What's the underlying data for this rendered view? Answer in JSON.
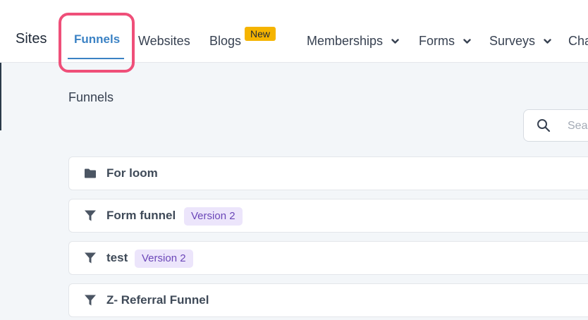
{
  "nav": {
    "title": "Sites",
    "items": [
      {
        "label": "Funnels",
        "active": true
      },
      {
        "label": "Websites"
      },
      {
        "label": "Blogs",
        "badge": "New"
      },
      {
        "label": "Memberships",
        "dropdown": true
      },
      {
        "label": "Forms",
        "dropdown": true
      },
      {
        "label": "Surveys",
        "dropdown": true
      },
      {
        "label": "Cha"
      }
    ]
  },
  "page": {
    "heading": "Funnels"
  },
  "search": {
    "placeholder": "Sea"
  },
  "rows": [
    {
      "name": "For loom",
      "icon": "folder-icon"
    },
    {
      "name": "Form funnel",
      "icon": "funnel-icon",
      "version": "Version 2"
    },
    {
      "name": "test",
      "icon": "funnel-icon",
      "version": "Version 2"
    },
    {
      "name": "Z- Referral Funnel",
      "icon": "funnel-icon"
    }
  ],
  "colors": {
    "accent": "#3b82c4",
    "highlight": "#ef4f79",
    "badge": "#f5b400",
    "version_bg": "#ece5fb",
    "version_text": "#6b46b8"
  }
}
